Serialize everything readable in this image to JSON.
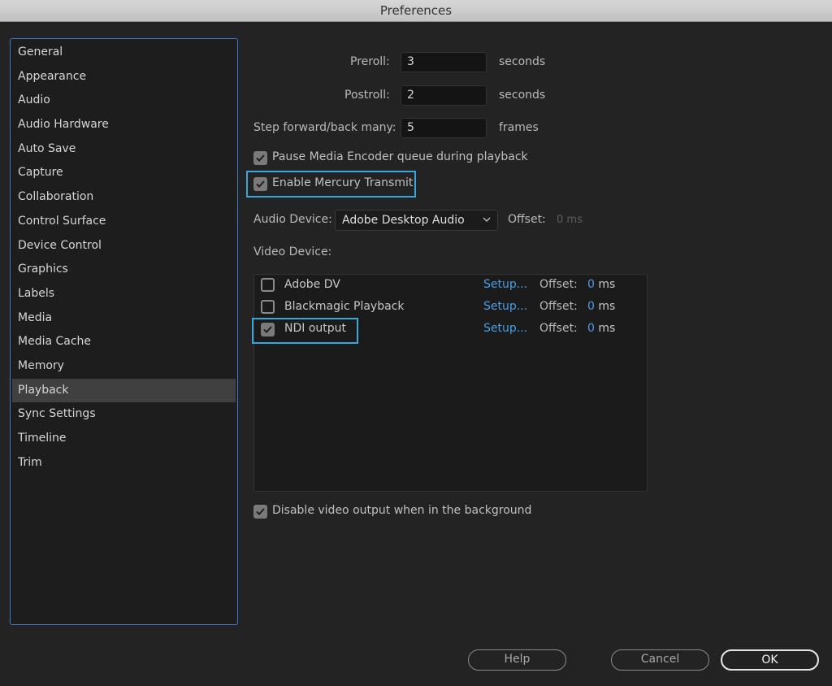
{
  "window": {
    "title": "Preferences"
  },
  "sidebar": {
    "items": [
      {
        "label": "General"
      },
      {
        "label": "Appearance"
      },
      {
        "label": "Audio"
      },
      {
        "label": "Audio Hardware"
      },
      {
        "label": "Auto Save"
      },
      {
        "label": "Capture"
      },
      {
        "label": "Collaboration"
      },
      {
        "label": "Control Surface"
      },
      {
        "label": "Device Control"
      },
      {
        "label": "Graphics"
      },
      {
        "label": "Labels"
      },
      {
        "label": "Media"
      },
      {
        "label": "Media Cache"
      },
      {
        "label": "Memory"
      },
      {
        "label": "Playback",
        "selected": true
      },
      {
        "label": "Sync Settings"
      },
      {
        "label": "Timeline"
      },
      {
        "label": "Trim"
      }
    ]
  },
  "playback": {
    "preroll": {
      "label": "Preroll:",
      "value": "3",
      "unit": "seconds"
    },
    "postroll": {
      "label": "Postroll:",
      "value": "2",
      "unit": "seconds"
    },
    "step": {
      "label": "Step forward/back many:",
      "value": "5",
      "unit": "frames"
    },
    "pause_encoder": {
      "label": "Pause Media Encoder queue during playback",
      "checked": true
    },
    "mercury_transmit": {
      "label": "Enable Mercury Transmit",
      "checked": true
    },
    "audio_device": {
      "label": "Audio Device:",
      "value": "Adobe Desktop Audio",
      "offset_label": "Offset:",
      "offset_value": "0 ms"
    },
    "video_device_label": "Video Device:",
    "video_devices": [
      {
        "name": "Adobe DV",
        "checked": false,
        "setup": "Setup...",
        "offset_label": "Offset:",
        "offset_value": "0",
        "offset_unit": "ms"
      },
      {
        "name": "Blackmagic Playback",
        "checked": false,
        "setup": "Setup...",
        "offset_label": "Offset:",
        "offset_value": "0",
        "offset_unit": "ms"
      },
      {
        "name": "NDI output",
        "checked": true,
        "setup": "Setup...",
        "offset_label": "Offset:",
        "offset_value": "0",
        "offset_unit": "ms"
      }
    ],
    "disable_background": {
      "label": "Disable video output when in the background",
      "checked": true
    }
  },
  "buttons": {
    "help": "Help",
    "cancel": "Cancel",
    "ok": "OK"
  },
  "colors": {
    "accent_blue": "#3c7ac4",
    "highlight": "#3aa7dc",
    "link": "#4a9ee6"
  }
}
